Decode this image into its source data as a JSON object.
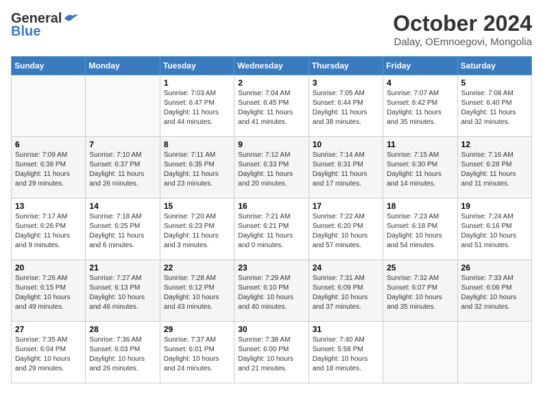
{
  "header": {
    "logo_general": "General",
    "logo_blue": "Blue",
    "month": "October 2024",
    "location": "Dalay, OEmnoegovi, Mongolia"
  },
  "days_of_week": [
    "Sunday",
    "Monday",
    "Tuesday",
    "Wednesday",
    "Thursday",
    "Friday",
    "Saturday"
  ],
  "weeks": [
    [
      {
        "day": "",
        "sunrise": "",
        "sunset": "",
        "daylight": ""
      },
      {
        "day": "",
        "sunrise": "",
        "sunset": "",
        "daylight": ""
      },
      {
        "day": "1",
        "sunrise": "Sunrise: 7:03 AM",
        "sunset": "Sunset: 6:47 PM",
        "daylight": "Daylight: 11 hours and 44 minutes."
      },
      {
        "day": "2",
        "sunrise": "Sunrise: 7:04 AM",
        "sunset": "Sunset: 6:45 PM",
        "daylight": "Daylight: 11 hours and 41 minutes."
      },
      {
        "day": "3",
        "sunrise": "Sunrise: 7:05 AM",
        "sunset": "Sunset: 6:44 PM",
        "daylight": "Daylight: 11 hours and 38 minutes."
      },
      {
        "day": "4",
        "sunrise": "Sunrise: 7:07 AM",
        "sunset": "Sunset: 6:42 PM",
        "daylight": "Daylight: 11 hours and 35 minutes."
      },
      {
        "day": "5",
        "sunrise": "Sunrise: 7:08 AM",
        "sunset": "Sunset: 6:40 PM",
        "daylight": "Daylight: 11 hours and 32 minutes."
      }
    ],
    [
      {
        "day": "6",
        "sunrise": "Sunrise: 7:09 AM",
        "sunset": "Sunset: 6:38 PM",
        "daylight": "Daylight: 11 hours and 29 minutes."
      },
      {
        "day": "7",
        "sunrise": "Sunrise: 7:10 AM",
        "sunset": "Sunset: 6:37 PM",
        "daylight": "Daylight: 11 hours and 26 minutes."
      },
      {
        "day": "8",
        "sunrise": "Sunrise: 7:11 AM",
        "sunset": "Sunset: 6:35 PM",
        "daylight": "Daylight: 11 hours and 23 minutes."
      },
      {
        "day": "9",
        "sunrise": "Sunrise: 7:12 AM",
        "sunset": "Sunset: 6:33 PM",
        "daylight": "Daylight: 11 hours and 20 minutes."
      },
      {
        "day": "10",
        "sunrise": "Sunrise: 7:14 AM",
        "sunset": "Sunset: 6:31 PM",
        "daylight": "Daylight: 11 hours and 17 minutes."
      },
      {
        "day": "11",
        "sunrise": "Sunrise: 7:15 AM",
        "sunset": "Sunset: 6:30 PM",
        "daylight": "Daylight: 11 hours and 14 minutes."
      },
      {
        "day": "12",
        "sunrise": "Sunrise: 7:16 AM",
        "sunset": "Sunset: 6:28 PM",
        "daylight": "Daylight: 11 hours and 11 minutes."
      }
    ],
    [
      {
        "day": "13",
        "sunrise": "Sunrise: 7:17 AM",
        "sunset": "Sunset: 6:26 PM",
        "daylight": "Daylight: 11 hours and 9 minutes."
      },
      {
        "day": "14",
        "sunrise": "Sunrise: 7:18 AM",
        "sunset": "Sunset: 6:25 PM",
        "daylight": "Daylight: 11 hours and 6 minutes."
      },
      {
        "day": "15",
        "sunrise": "Sunrise: 7:20 AM",
        "sunset": "Sunset: 6:23 PM",
        "daylight": "Daylight: 11 hours and 3 minutes."
      },
      {
        "day": "16",
        "sunrise": "Sunrise: 7:21 AM",
        "sunset": "Sunset: 6:21 PM",
        "daylight": "Daylight: 11 hours and 0 minutes."
      },
      {
        "day": "17",
        "sunrise": "Sunrise: 7:22 AM",
        "sunset": "Sunset: 6:20 PM",
        "daylight": "Daylight: 10 hours and 57 minutes."
      },
      {
        "day": "18",
        "sunrise": "Sunrise: 7:23 AM",
        "sunset": "Sunset: 6:18 PM",
        "daylight": "Daylight: 10 hours and 54 minutes."
      },
      {
        "day": "19",
        "sunrise": "Sunrise: 7:24 AM",
        "sunset": "Sunset: 6:16 PM",
        "daylight": "Daylight: 10 hours and 51 minutes."
      }
    ],
    [
      {
        "day": "20",
        "sunrise": "Sunrise: 7:26 AM",
        "sunset": "Sunset: 6:15 PM",
        "daylight": "Daylight: 10 hours and 49 minutes."
      },
      {
        "day": "21",
        "sunrise": "Sunrise: 7:27 AM",
        "sunset": "Sunset: 6:13 PM",
        "daylight": "Daylight: 10 hours and 46 minutes."
      },
      {
        "day": "22",
        "sunrise": "Sunrise: 7:28 AM",
        "sunset": "Sunset: 6:12 PM",
        "daylight": "Daylight: 10 hours and 43 minutes."
      },
      {
        "day": "23",
        "sunrise": "Sunrise: 7:29 AM",
        "sunset": "Sunset: 6:10 PM",
        "daylight": "Daylight: 10 hours and 40 minutes."
      },
      {
        "day": "24",
        "sunrise": "Sunrise: 7:31 AM",
        "sunset": "Sunset: 6:09 PM",
        "daylight": "Daylight: 10 hours and 37 minutes."
      },
      {
        "day": "25",
        "sunrise": "Sunrise: 7:32 AM",
        "sunset": "Sunset: 6:07 PM",
        "daylight": "Daylight: 10 hours and 35 minutes."
      },
      {
        "day": "26",
        "sunrise": "Sunrise: 7:33 AM",
        "sunset": "Sunset: 6:06 PM",
        "daylight": "Daylight: 10 hours and 32 minutes."
      }
    ],
    [
      {
        "day": "27",
        "sunrise": "Sunrise: 7:35 AM",
        "sunset": "Sunset: 6:04 PM",
        "daylight": "Daylight: 10 hours and 29 minutes."
      },
      {
        "day": "28",
        "sunrise": "Sunrise: 7:36 AM",
        "sunset": "Sunset: 6:03 PM",
        "daylight": "Daylight: 10 hours and 26 minutes."
      },
      {
        "day": "29",
        "sunrise": "Sunrise: 7:37 AM",
        "sunset": "Sunset: 6:01 PM",
        "daylight": "Daylight: 10 hours and 24 minutes."
      },
      {
        "day": "30",
        "sunrise": "Sunrise: 7:38 AM",
        "sunset": "Sunset: 6:00 PM",
        "daylight": "Daylight: 10 hours and 21 minutes."
      },
      {
        "day": "31",
        "sunrise": "Sunrise: 7:40 AM",
        "sunset": "Sunset: 5:58 PM",
        "daylight": "Daylight: 10 hours and 18 minutes."
      },
      {
        "day": "",
        "sunrise": "",
        "sunset": "",
        "daylight": ""
      },
      {
        "day": "",
        "sunrise": "",
        "sunset": "",
        "daylight": ""
      }
    ]
  ]
}
